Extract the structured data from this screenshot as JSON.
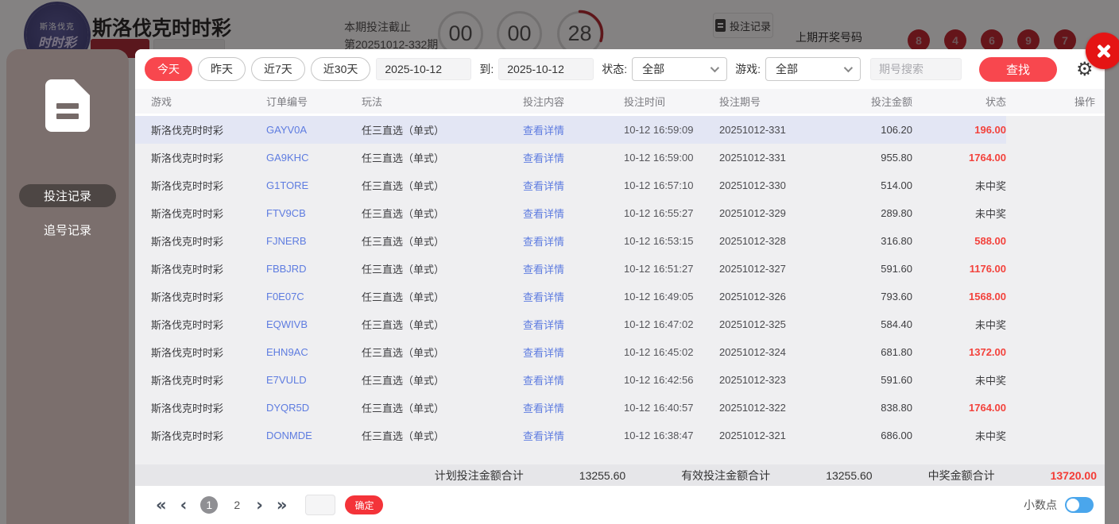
{
  "colors": {
    "accent": "#f8474e",
    "win_red": "#f3423c",
    "link_blue": "#5e7ce0",
    "ball_red": "#bf1c26",
    "toggle_blue": "#4aa6ec",
    "sidebar_bg": "#7b6f6d"
  },
  "page": {
    "title": "斯洛伐克时时彩",
    "logo_line1": "斯洛伐克",
    "logo_line2": "时时彩",
    "deadline_label": "本期投注截止",
    "period_label": "第20251012-332期",
    "countdown": {
      "hours": "00",
      "minutes": "00",
      "seconds": "28"
    },
    "bet_record_button": "投注记录",
    "last_draw_label": "上期开奖号码",
    "last_draw_numbers": [
      "8",
      "4",
      "6",
      "9",
      "7"
    ]
  },
  "sidebar": {
    "items": [
      {
        "label": "投注记录",
        "active": true
      },
      {
        "label": "追号记录",
        "active": false
      }
    ]
  },
  "modal": {
    "filters": {
      "quick_ranges": [
        "今天",
        "昨天",
        "近7天",
        "近30天"
      ],
      "date_from": "2025-10-12",
      "to_label": "到:",
      "date_to": "2025-10-12",
      "status_label": "状态:",
      "status_value": "全部",
      "game_label": "游戏:",
      "game_value": "全部",
      "search_placeholder": "期号搜索",
      "find_button": "查找"
    },
    "table": {
      "headers": [
        "游戏",
        "订单编号",
        "玩法",
        "投注内容",
        "投注时间",
        "投注期号",
        "投注金额",
        "状态",
        "操作"
      ],
      "rows": [
        {
          "game": "斯洛伐克时时彩",
          "order": "GAYV0A",
          "play": "任三直选（单式）",
          "content": "查看详情",
          "time": "10-12 16:59:09",
          "period": "20251012-331",
          "amount": "106.20",
          "status": "196.00",
          "win": true,
          "highlight": true
        },
        {
          "game": "斯洛伐克时时彩",
          "order": "GA9KHC",
          "play": "任三直选（单式）",
          "content": "查看详情",
          "time": "10-12 16:59:00",
          "period": "20251012-331",
          "amount": "955.80",
          "status": "1764.00",
          "win": true,
          "highlight": false
        },
        {
          "game": "斯洛伐克时时彩",
          "order": "G1TORE",
          "play": "任三直选（单式）",
          "content": "查看详情",
          "time": "10-12 16:57:10",
          "period": "20251012-330",
          "amount": "514.00",
          "status": "未中奖",
          "win": false,
          "highlight": false
        },
        {
          "game": "斯洛伐克时时彩",
          "order": "FTV9CB",
          "play": "任三直选（单式）",
          "content": "查看详情",
          "time": "10-12 16:55:27",
          "period": "20251012-329",
          "amount": "289.80",
          "status": "未中奖",
          "win": false,
          "highlight": false
        },
        {
          "game": "斯洛伐克时时彩",
          "order": "FJNERB",
          "play": "任三直选（单式）",
          "content": "查看详情",
          "time": "10-12 16:53:15",
          "period": "20251012-328",
          "amount": "316.80",
          "status": "588.00",
          "win": true,
          "highlight": false
        },
        {
          "game": "斯洛伐克时时彩",
          "order": "FBBJRD",
          "play": "任三直选（单式）",
          "content": "查看详情",
          "time": "10-12 16:51:27",
          "period": "20251012-327",
          "amount": "591.60",
          "status": "1176.00",
          "win": true,
          "highlight": false
        },
        {
          "game": "斯洛伐克时时彩",
          "order": "F0E07C",
          "play": "任三直选（单式）",
          "content": "查看详情",
          "time": "10-12 16:49:05",
          "period": "20251012-326",
          "amount": "793.60",
          "status": "1568.00",
          "win": true,
          "highlight": false
        },
        {
          "game": "斯洛伐克时时彩",
          "order": "EQWIVB",
          "play": "任三直选（单式）",
          "content": "查看详情",
          "time": "10-12 16:47:02",
          "period": "20251012-325",
          "amount": "584.40",
          "status": "未中奖",
          "win": false,
          "highlight": false
        },
        {
          "game": "斯洛伐克时时彩",
          "order": "EHN9AC",
          "play": "任三直选（单式）",
          "content": "查看详情",
          "time": "10-12 16:45:02",
          "period": "20251012-324",
          "amount": "681.80",
          "status": "1372.00",
          "win": true,
          "highlight": false
        },
        {
          "game": "斯洛伐克时时彩",
          "order": "E7VULD",
          "play": "任三直选（单式）",
          "content": "查看详情",
          "time": "10-12 16:42:56",
          "period": "20251012-323",
          "amount": "591.60",
          "status": "未中奖",
          "win": false,
          "highlight": false
        },
        {
          "game": "斯洛伐克时时彩",
          "order": "DYQR5D",
          "play": "任三直选（单式）",
          "content": "查看详情",
          "time": "10-12 16:40:57",
          "period": "20251012-322",
          "amount": "838.80",
          "status": "1764.00",
          "win": true,
          "highlight": false
        },
        {
          "game": "斯洛伐克时时彩",
          "order": "DONMDE",
          "play": "任三直选（单式）",
          "content": "查看详情",
          "time": "10-12 16:38:47",
          "period": "20251012-321",
          "amount": "686.00",
          "status": "未中奖",
          "win": false,
          "highlight": false
        }
      ]
    },
    "summary": {
      "planned_label": "计划投注金额合计",
      "planned_value": "13255.60",
      "valid_label": "有效投注金额合计",
      "valid_value": "13255.60",
      "win_label": "中奖金额合计",
      "win_value": "13720.00"
    },
    "pagination": {
      "pages": [
        "1",
        "2"
      ],
      "current": "1",
      "confirm_button": "确定"
    },
    "decimal_toggle_label": "小数点"
  }
}
